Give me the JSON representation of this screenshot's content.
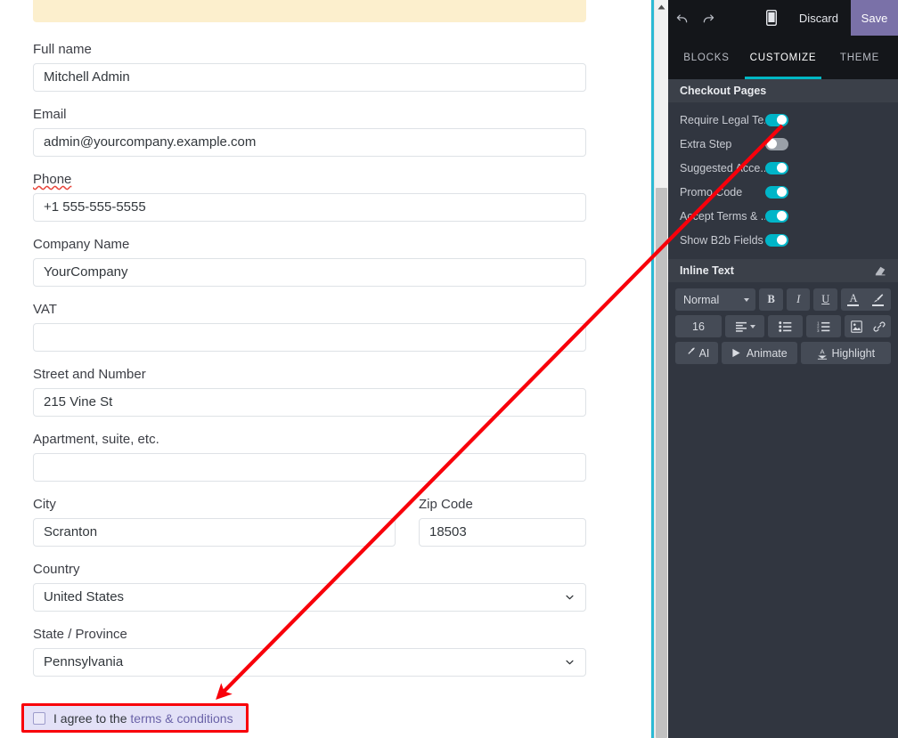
{
  "preview": {
    "notice_banner": {
      "name": "info-banner"
    },
    "fields": [
      {
        "label": "Full name",
        "value": "Mitchell Admin",
        "type": "text",
        "spellcheck_error": false
      },
      {
        "label": "Email",
        "value": "admin@yourcompany.example.com",
        "type": "text",
        "spellcheck_error": false
      },
      {
        "label": "Phone",
        "value": "+1 555-555-5555",
        "type": "text",
        "spellcheck_error": true
      },
      {
        "label": "Company Name",
        "value": "YourCompany",
        "type": "text",
        "spellcheck_error": false
      },
      {
        "label": "VAT",
        "value": "",
        "type": "text",
        "spellcheck_error": false
      },
      {
        "label": "Street and Number",
        "value": "215 Vine St",
        "type": "text",
        "spellcheck_error": false
      },
      {
        "label": "Apartment, suite, etc.",
        "value": "",
        "type": "text",
        "spellcheck_error": false
      }
    ],
    "city": {
      "label": "City",
      "value": "Scranton"
    },
    "zip": {
      "label": "Zip Code",
      "value": "18503"
    },
    "country": {
      "label": "Country",
      "value": "United States"
    },
    "state": {
      "label": "State / Province",
      "value": "Pennsylvania"
    },
    "agree": {
      "prefix_text": "I agree to the ",
      "link_text": "terms & conditions",
      "checked": false,
      "highlight_color": "#f8000a",
      "background_color": "#e3e1f7"
    }
  },
  "scrollbar": {
    "up_arrow": "scroll-up-arrow"
  },
  "panel": {
    "topbar": {
      "undo": "undo-icon",
      "redo": "redo-icon",
      "mobile_preview": "mobile-icon",
      "discard_label": "Discard",
      "save_label": "Save",
      "save_color": "#7a71a8"
    },
    "tabs": [
      {
        "label": "BLOCKS",
        "active": false
      },
      {
        "label": "CUSTOMIZE",
        "active": true
      },
      {
        "label": "THEME",
        "active": false
      }
    ],
    "accent_color": "#00b8c4",
    "checkout_section": {
      "title": "Checkout Pages",
      "options": [
        {
          "label": "Require Legal Te...",
          "on": true
        },
        {
          "label": "Extra Step",
          "on": false
        },
        {
          "label": "Suggested Acce...",
          "on": true
        },
        {
          "label": "Promo Code",
          "on": true
        },
        {
          "label": "Accept Terms & ...",
          "on": true
        },
        {
          "label": "Show B2b Fields",
          "on": true
        }
      ]
    },
    "inline_text_section": {
      "title": "Inline Text",
      "eraser_icon": "eraser-icon",
      "style_select": "Normal",
      "bold_label": "B",
      "italic_label": "I",
      "underline_label": "U",
      "font_color_label": "A",
      "font_size": "16",
      "ai_label": "AI",
      "animate_label": "Animate",
      "highlight_label": "Highlight"
    }
  },
  "annotation": {
    "arrow_color": "#f8000a",
    "from_label": "Require Legal Te... toggle",
    "to_label": "I agree to the terms & conditions checkbox"
  }
}
